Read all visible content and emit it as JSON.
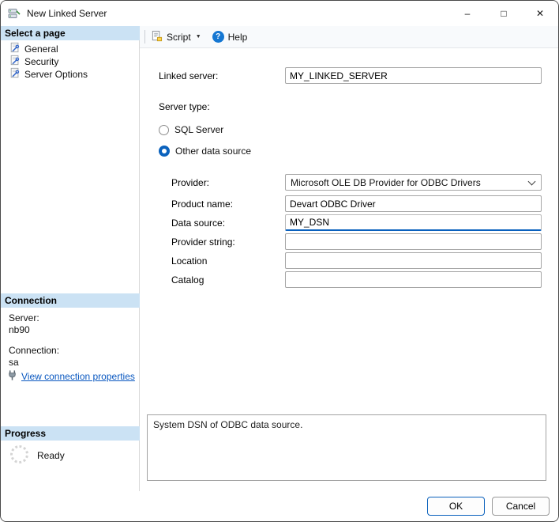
{
  "window": {
    "title": "New Linked Server",
    "controls": {
      "minimize": "–",
      "maximize": "□",
      "close": "✕"
    }
  },
  "toolbar": {
    "script_label": "Script",
    "script_dropdown_glyph": "▼",
    "help_glyph": "?",
    "help_label": "Help"
  },
  "sidebar": {
    "select_page": {
      "header": "Select a page",
      "items": [
        {
          "label": "General"
        },
        {
          "label": "Security"
        },
        {
          "label": "Server Options"
        }
      ]
    },
    "connection": {
      "header": "Connection",
      "server_label": "Server:",
      "server_value": "nb90",
      "connection_label": "Connection:",
      "connection_value": "sa",
      "link_label": "View connection properties"
    },
    "progress": {
      "header": "Progress",
      "status": "Ready"
    }
  },
  "form": {
    "linked_server": {
      "label": "Linked server:",
      "value": "MY_LINKED_SERVER"
    },
    "server_type_label": "Server type:",
    "radios": [
      {
        "label": "SQL Server",
        "selected": false
      },
      {
        "label": "Other data source",
        "selected": true
      }
    ],
    "provider": {
      "label": "Provider:",
      "value": "Microsoft OLE DB Provider for ODBC Drivers"
    },
    "product_name": {
      "label": "Product name:",
      "value": "Devart ODBC Driver"
    },
    "data_source": {
      "label": "Data source:",
      "value": "MY_DSN"
    },
    "provider_string": {
      "label": "Provider string:",
      "value": ""
    },
    "location": {
      "label": "Location",
      "value": ""
    },
    "catalog": {
      "label": "Catalog",
      "value": ""
    },
    "description": "System DSN of ODBC data source."
  },
  "footer": {
    "ok_label": "OK",
    "cancel_label": "Cancel"
  },
  "colors": {
    "accent": "#0b62bd",
    "section_header_bg": "#cbe2f4",
    "link": "#0a58c0",
    "help_badge": "#1577d2"
  }
}
